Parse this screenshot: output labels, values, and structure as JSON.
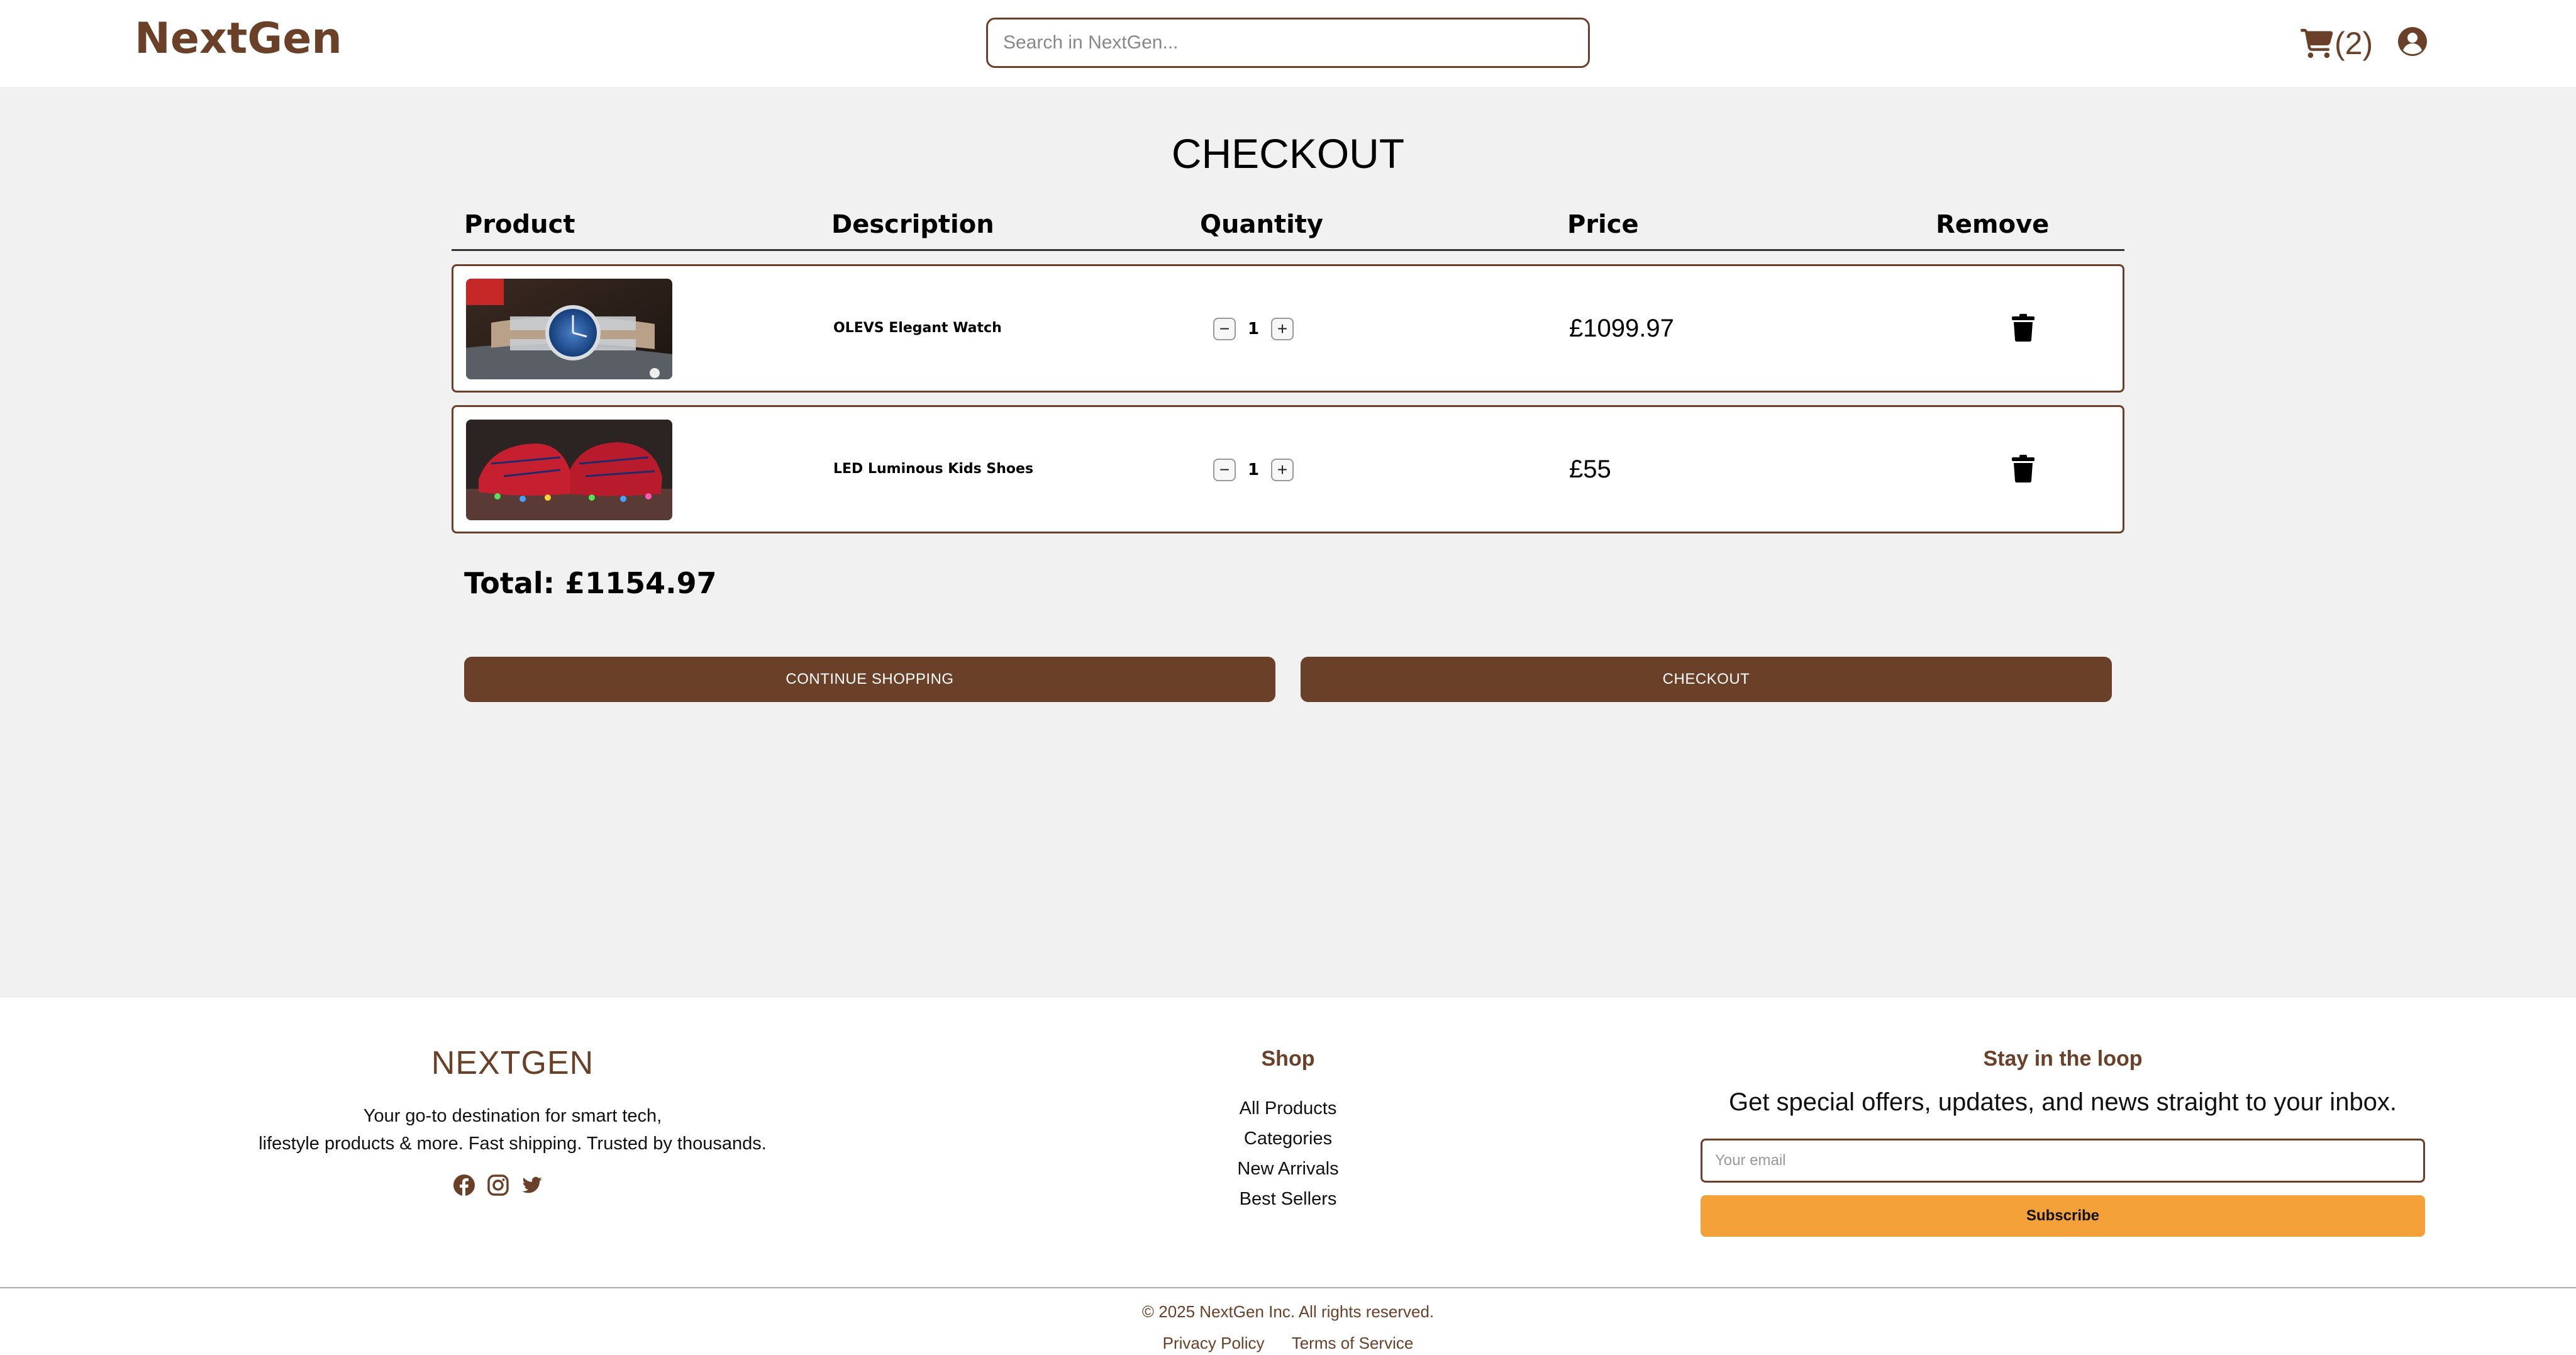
{
  "brand": {
    "logo": "NextGen",
    "color": "#6a4128"
  },
  "header": {
    "search_placeholder": "Search in NextGen...",
    "cart_count": "(2)",
    "cart_icon": "cart-icon",
    "user_icon": "user-circle-icon"
  },
  "main": {
    "title": "CHECKOUT",
    "columns": {
      "product": "Product",
      "description": "Description",
      "quantity": "Quantity",
      "price": "Price",
      "remove": "Remove"
    },
    "items": [
      {
        "name": "OLEVS Elegant Watch",
        "quantity": "1",
        "price": "£1099.97",
        "image": "watch-image"
      },
      {
        "name": "LED Luminous Kids Shoes",
        "quantity": "1",
        "price": "£55",
        "image": "shoes-image"
      }
    ],
    "qty_minus": "−",
    "qty_plus": "+",
    "total": "Total: £1154.97",
    "continue_label": "CONTINUE SHOPPING",
    "checkout_label": "CHECKOUT"
  },
  "footer": {
    "brand": "NEXTGEN",
    "tagline_line1": "Your go-to destination for smart tech,",
    "tagline_line2": "lifestyle products & more. Fast shipping. Trusted by thousands.",
    "social_icons": [
      "facebook-icon",
      "instagram-icon",
      "twitter-icon"
    ],
    "shop_heading": "Shop",
    "shop_links": [
      "All Products",
      "Categories",
      "New Arrivals",
      "Best Sellers"
    ],
    "loop_heading": "Stay in the loop",
    "loop_sub": "Get special offers, updates, and news straight to your inbox.",
    "email_placeholder": "Your email",
    "subscribe_label": "Subscribe",
    "accent_color": "#f4a13a",
    "copyright": "© 2025 NextGen Inc. All rights reserved.",
    "privacy": "Privacy Policy",
    "terms": "Terms of Service"
  }
}
